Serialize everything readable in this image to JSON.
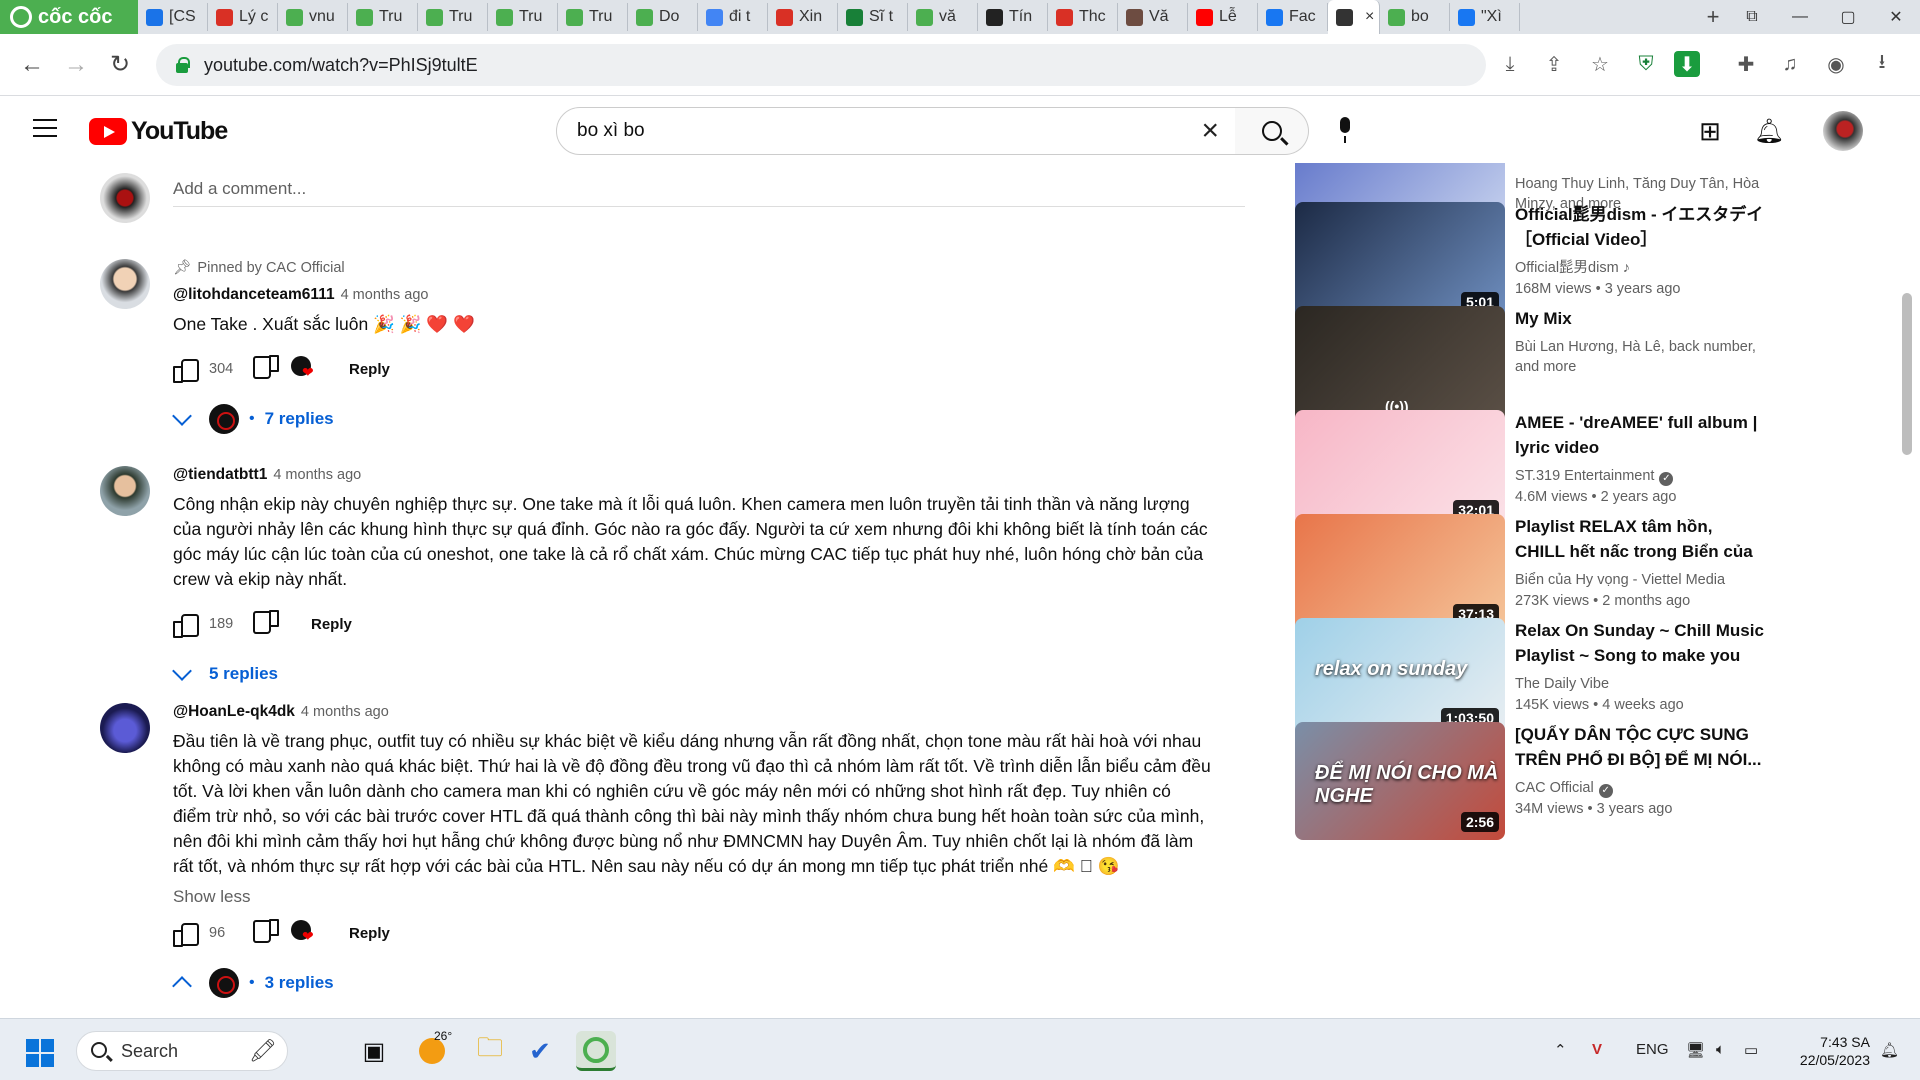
{
  "browser": {
    "brand": "cốc cốc",
    "tabs": [
      {
        "label": "[CS",
        "icon": "docs-icon",
        "color": "#1a73e8"
      },
      {
        "label": "Lý c",
        "icon": "x-icon",
        "color": "#d93025"
      },
      {
        "label": "vnu",
        "icon": "coccoc-icon",
        "color": "#4caf50"
      },
      {
        "label": "Tru",
        "icon": "globe-icon",
        "color": "#4caf50"
      },
      {
        "label": "Tru",
        "icon": "globe-icon",
        "color": "#4caf50"
      },
      {
        "label": "Tru",
        "icon": "globe-icon",
        "color": "#4caf50"
      },
      {
        "label": "Tru",
        "icon": "globe-icon",
        "color": "#4caf50"
      },
      {
        "label": "Do",
        "icon": "globe-icon",
        "color": "#4caf50"
      },
      {
        "label": "đi t",
        "icon": "google-icon",
        "color": "#4285f4"
      },
      {
        "label": "Xin",
        "icon": "flag-icon",
        "color": "#d93025"
      },
      {
        "label": "Sĩ t",
        "icon": "grid-icon",
        "color": "#188038"
      },
      {
        "label": "vă",
        "icon": "coccoc-icon",
        "color": "#4caf50"
      },
      {
        "label": "Tín",
        "icon": "wiki-icon",
        "color": "#222222"
      },
      {
        "label": "Thc",
        "icon": "flag-icon",
        "color": "#d93025"
      },
      {
        "label": "Vă",
        "icon": "person-icon",
        "color": "#6d4c41"
      },
      {
        "label": "Lễ",
        "icon": "youtube-icon",
        "color": "#ff0000"
      },
      {
        "label": "Fac",
        "icon": "facebook-icon",
        "color": "#1877f2"
      },
      {
        "label": "",
        "icon": "speaker-icon",
        "color": "#333333",
        "active": true
      },
      {
        "label": "bo",
        "icon": "coccoc-icon",
        "color": "#4caf50"
      },
      {
        "label": "\"Xì",
        "icon": "facebook-icon",
        "color": "#1877f2"
      }
    ],
    "url": "youtube.com/watch?v=PhISj9tultE"
  },
  "youtube": {
    "logo_text": "YouTube",
    "search_value": "bo xì bo",
    "add_comment_placeholder": "Add a comment...",
    "comments": [
      {
        "pinned": "Pinned by CAC Official",
        "author": "@litohdanceteam6111",
        "time": "4 months ago",
        "text": "One Take . Xuất sắc luôn 🎉 🎉 ❤️ ❤️",
        "likes": "304",
        "reply_label": "Reply",
        "replies": "7 replies",
        "hearted": true,
        "expanded": false
      },
      {
        "author": "@tiendatbtt1",
        "time": "4 months ago",
        "text": "Công nhận ekip này chuyên nghiệp thực sự. One take mà ít lỗi quá luôn. Khen camera men luôn truyền tải tinh thần và năng lượng của người nhảy lên các khung hình thực sự quá đỉnh. Góc nào ra góc đấy. Người ta cứ xem nhưng đôi khi không biết là tính toán các góc máy lúc cận lúc toàn của cú oneshot, one take là cả rổ chất xám. Chúc mừng CAC tiếp tục phát huy nhé, luôn hóng chờ bản của crew và ekip này nhất.",
        "likes": "189",
        "reply_label": "Reply",
        "replies": "5 replies",
        "hearted": false,
        "expanded": false
      },
      {
        "author": "@HoanLe-qk4dk",
        "time": "4 months ago",
        "text": "Đầu tiên là về trang phục, outfit tuy có nhiều sự khác biệt về kiểu dáng nhưng vẫn rất đồng nhất, chọn tone màu rất hài hoà với nhau không có màu xanh nào quá khác biệt. Thứ hai là về độ đồng đều trong vũ đạo thì cả nhóm làm rất tốt. Về trình diễn lẫn biểu cảm đều tốt. Và lời khen vẫn luôn dành cho camera man khi có nghiên cứu về góc máy nên mới có những shot hình rất đẹp. Tuy nhiên có điểm trừ nhỏ, so với các bài trước cover HTL đã quá thành công thì bài này mình thấy nhóm chưa bung hết hoàn toàn sức của mình, nên đôi khi mình cảm thấy hơi hụt hẫng chứ không được bùng nổ như ĐMNCMN hay Duyên Âm. Tuy nhiên chốt lại là nhóm đã làm rất tốt, và nhóm thực sự rất hợp với các bài của HTL. Nên sau này nếu có dự án mong mn tiếp tục phát triển nhé 🫶 🏻 😘",
        "show_less": "Show less",
        "likes": "96",
        "reply_label": "Reply",
        "replies": "3 replies",
        "hearted": true,
        "expanded": true
      }
    ],
    "sidebar": [
      {
        "title": "",
        "channel": "Hoang Thuy Linh, Tăng Duy Tân, Hòa Minzy, and more",
        "meta": "",
        "duration": "",
        "mix": true,
        "thumb": [
          "#5a6fc7",
          "#cbd6f0"
        ]
      },
      {
        "title": "Official髭男dism - イエスタデイ［Official Video］",
        "channel": "Official髭男dism ♪",
        "meta": "168M views  •  3 years ago",
        "duration": "5:01",
        "mix": false,
        "thumb": [
          "#1c2a45",
          "#6f8fc0"
        ],
        "progress": 1.0
      },
      {
        "title": "My Mix",
        "channel": "Bùi Lan Hương, Hà Lê, back number, and more",
        "meta": "",
        "duration": "",
        "mix": true,
        "thumb": [
          "#2b2722",
          "#5b5046"
        ]
      },
      {
        "title": "AMEE - 'dreAMEE' full album | lyric video",
        "channel": "ST.319 Entertainment",
        "verified": true,
        "meta": "4.6M views  •  2 years ago",
        "duration": "32:01",
        "mix": false,
        "thumb": [
          "#f7b6c6",
          "#fbe2e8"
        ],
        "progress": 1.0
      },
      {
        "title": "Playlist RELAX tâm hồn, CHILL hết nấc trong Biển của hy vọng",
        "channel": "Biển của Hy vọng - Viettel Media",
        "meta": "273K views  •  2 months ago",
        "duration": "37:13",
        "mix": false,
        "thumb": [
          "#e8754a",
          "#f5c59a"
        ],
        "progress": 1.0
      },
      {
        "title": "Relax On Sunday ~ Chill Music Playlist ~ Song to make you fe...",
        "channel": "The Daily Vibe",
        "meta": "145K views  •  4 weeks ago",
        "duration": "1:03:50",
        "mix": false,
        "thumb": [
          "#9fd0e8",
          "#e8eef2"
        ],
        "overlay": "relax on sunday"
      },
      {
        "title": "[QUẨY DÂN TỘC CỰC SUNG TRÊN PHỐ ĐI BỘ] ĐỂ MỊ NÓI...",
        "channel": "CAC Official",
        "verified": true,
        "meta": "34M views  •  3 years ago",
        "duration": "2:56",
        "mix": false,
        "thumb": [
          "#7a8fa8",
          "#c44a3a"
        ],
        "overlay": "ĐỂ MỊ NÓI CHO MÀ NGHE"
      }
    ]
  },
  "taskbar": {
    "search_placeholder": "Search",
    "weather": "26°",
    "lang": "ENG",
    "time": "7:43 SA",
    "date": "22/05/2023"
  }
}
